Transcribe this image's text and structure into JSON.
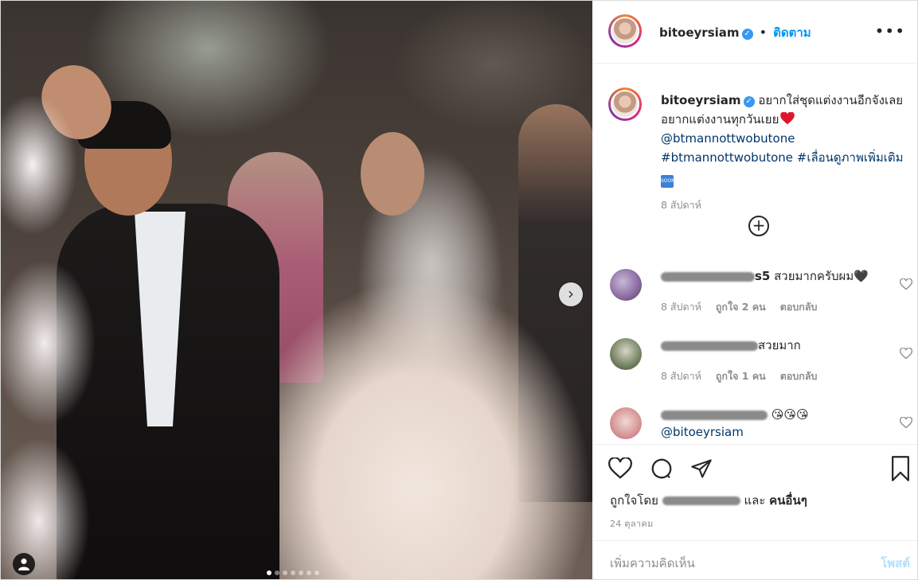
{
  "post": {
    "username": "bitoeyrsiam",
    "follow_label": "ติดตาม",
    "more_icon": "more-options-icon",
    "caption_text": "อยากใส่ชุดแต่งงานอีกจังเลย อยากแต่งงานทุกวันเยย",
    "caption_mention": "@btmannottwobutone",
    "caption_hashtag": "#btmannottwobutone",
    "caption_hashtag2": "#เลื่อนดูภาพเพิ่มเติม",
    "caption_time": "8 สัปดาห์",
    "image_count_dots": 7,
    "active_dot": 0
  },
  "comments": [
    {
      "name_visible": "s5",
      "text": "สวยมากครับผม🖤",
      "time": "8 สัปดาห์",
      "likes": "ถูกใจ 2 คน",
      "reply": "ตอบกลับ"
    },
    {
      "name_visible": "",
      "text": "สวยมาก",
      "time": "8 สัปดาห์",
      "likes": "ถูกใจ 1 คน",
      "reply": "ตอบกลับ"
    },
    {
      "name_visible": "",
      "text": "😘😘😘",
      "mention": "@bitoeyrsiam"
    }
  ],
  "actions": {
    "liked_by_prefix": "ถูกใจโดย",
    "liked_by_suffix": "และ",
    "others": "คนอื่นๆ",
    "date": "24 ตุลาคม"
  },
  "add_comment": {
    "placeholder": "เพิ่มความคิดเห็น",
    "post_label": "โพสต์"
  },
  "colors": {
    "link": "#00376b",
    "follow": "#0095f6",
    "post_disabled": "#b2dffc",
    "verified": "#3897f0"
  }
}
